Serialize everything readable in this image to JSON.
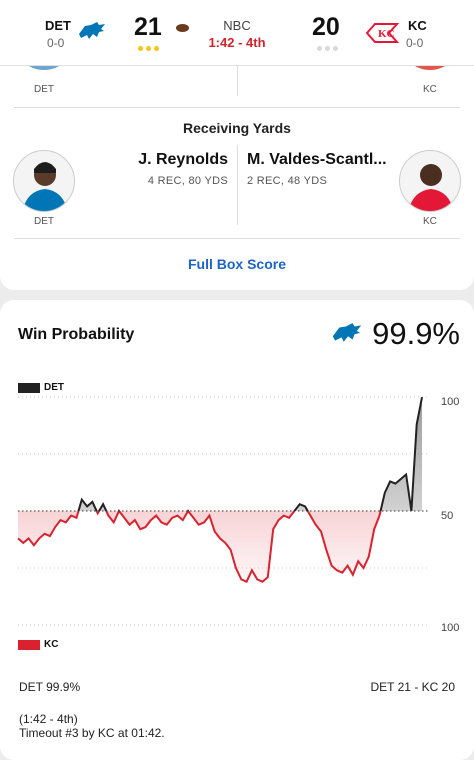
{
  "header": {
    "home": {
      "abbr": "DET",
      "record": "0-0",
      "score": "21",
      "logo": "lions-logo"
    },
    "away": {
      "abbr": "KC",
      "record": "0-0",
      "score": "20",
      "logo": "chiefs-logo"
    },
    "network": "NBC",
    "clock": "1:42 - 4th",
    "colors": {
      "det": "#0076b6",
      "kc": "#e31837",
      "timeout_dot": "#f5c518",
      "clock": "#d0242b"
    }
  },
  "leaders": {
    "prev_row": {
      "left_team": "DET",
      "right_team": "KC"
    },
    "receiving": {
      "title": "Receiving Yards",
      "left": {
        "name": "J. Reynolds",
        "stats": "4 REC, 80 YDS",
        "team": "DET"
      },
      "right": {
        "name": "M. Valdes-Scantl...",
        "stats": "2 REC, 48 YDS",
        "team": "KC"
      }
    },
    "full_box_score": "Full Box Score"
  },
  "win_probability": {
    "title": "Win Probability",
    "value": "99.9%",
    "legend_top": "DET",
    "legend_bottom": "KC",
    "axis_top": "100",
    "axis_mid": "50",
    "axis_bottom": "100",
    "footer_left": "DET 99.9%",
    "footer_right": "DET 21 - KC 20",
    "play_time": "(1:42 - 4th)",
    "play_desc": "Timeout #3 by KC at 01:42."
  },
  "chart_data": {
    "type": "area",
    "x_label": "",
    "y_label": "",
    "ylim": [
      0,
      100
    ],
    "baseline": 50,
    "colors": {
      "above": "#222222",
      "below": "#d9222e"
    },
    "series": [
      {
        "values": [
          38,
          36,
          38,
          35,
          38,
          40,
          39,
          43,
          46,
          45,
          48,
          47,
          55,
          52,
          54,
          49,
          53,
          48,
          45,
          50,
          47,
          44,
          46,
          42,
          43,
          46,
          48,
          45,
          44,
          47,
          48,
          46,
          50,
          47,
          44,
          45,
          48,
          41,
          38,
          36,
          33,
          25,
          20,
          19,
          24,
          20,
          19,
          21,
          42,
          46,
          48,
          47,
          50,
          53,
          52,
          48,
          44,
          41,
          33,
          26,
          24,
          23,
          26,
          22,
          28,
          25,
          30,
          42,
          48,
          58,
          63,
          62,
          64,
          66,
          50,
          88,
          99.9
        ]
      }
    ]
  }
}
